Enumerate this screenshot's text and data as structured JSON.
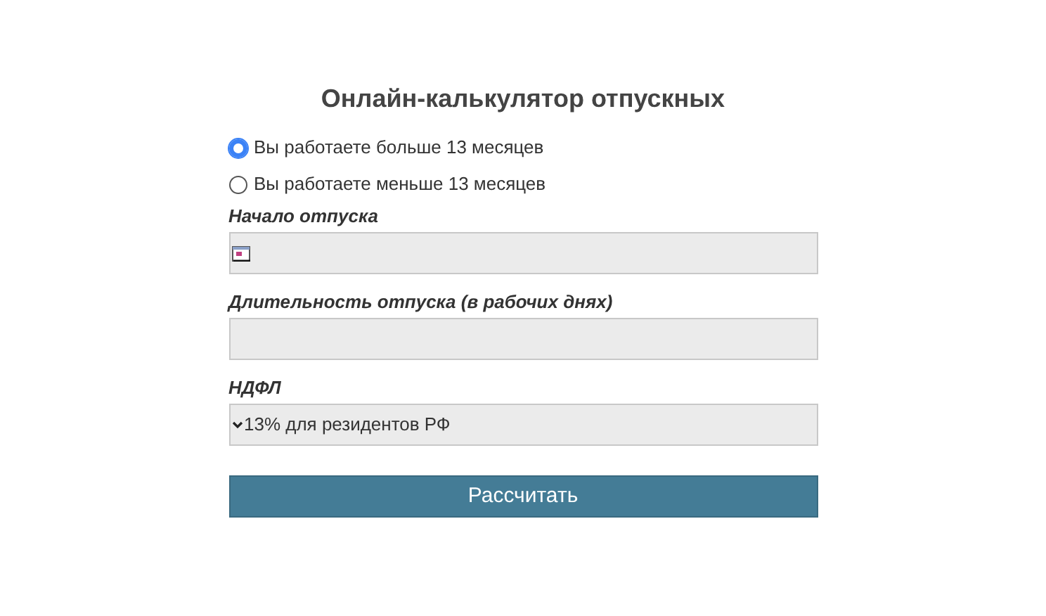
{
  "title": "Онлайн-калькулятор отпускных",
  "options": [
    {
      "label": "Вы работаете больше 13 месяцев",
      "selected": true
    },
    {
      "label": "Вы работаете меньше 13 месяцев",
      "selected": false
    }
  ],
  "fields": [
    {
      "kind": "date",
      "label": "Начало отпуска"
    },
    {
      "kind": "text",
      "label": "Длительность отпуска (в рабочих днях)"
    },
    {
      "kind": "select",
      "label": "НДФЛ",
      "value": "13% для резидентов РФ"
    }
  ],
  "button": "Рассчитать"
}
